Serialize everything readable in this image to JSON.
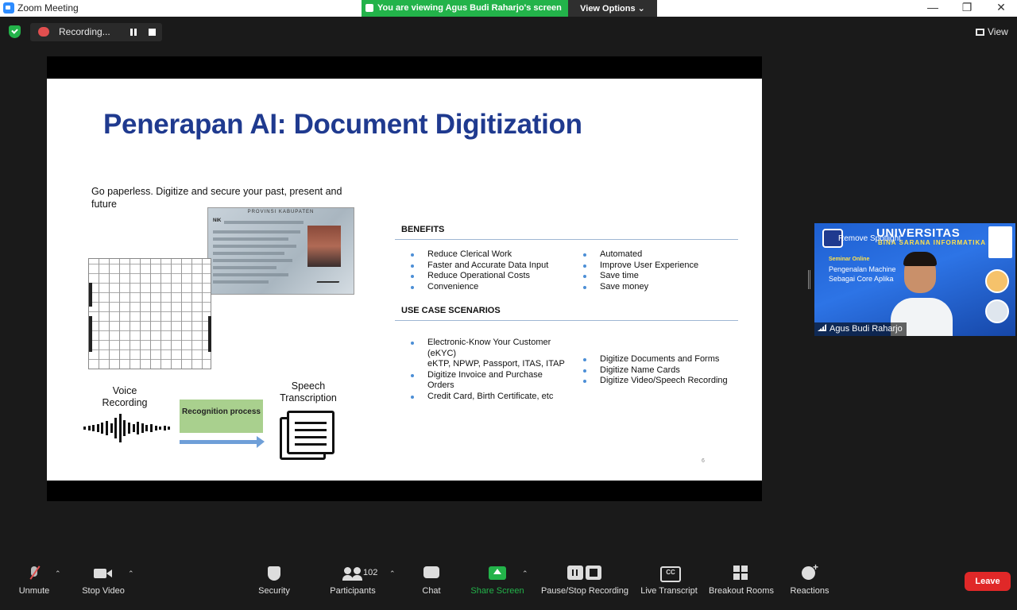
{
  "window": {
    "title": "Zoom Meeting",
    "share_banner": "You are viewing Agus Budi Raharjo's screen",
    "view_options_label": "View Options ⌄"
  },
  "top": {
    "recording_label": "Recording...",
    "view_label": "View"
  },
  "slide": {
    "title": "Penerapan AI: Document Digitization",
    "intro": "Go paperless. Digitize and secure your past, present and future",
    "voice_label": "Voice Recording",
    "recognition_label": "Recognition process",
    "speech_label": "Speech Transcription",
    "id_card_header": "PROVINSI KABUPATEN",
    "id_card_nik": "NIK",
    "benefits_heading": "BENEFITS",
    "benefits_left": [
      "Reduce Clerical Work",
      "Faster and Accurate Data Input",
      "Reduce Operational Costs",
      "Convenience"
    ],
    "benefits_right": [
      "Automated",
      "Improve User Experience",
      "Save time",
      "Save money"
    ],
    "usecase_heading": "USE CASE SCENARIOS",
    "usecase_left": [
      {
        "text": "Electronic-Know Your Customer",
        "cont": false
      },
      {
        "text": "(eKYC)",
        "cont": true
      },
      {
        "text": "eKTP, NPWP, Passport, ITAS, ITAP",
        "cont": true
      },
      {
        "text": "Digitize Invoice and Purchase",
        "cont": false
      },
      {
        "text": "Orders",
        "cont": true
      },
      {
        "text": "Credit Card, Birth Certificate, etc",
        "cont": false
      }
    ],
    "usecase_right": [
      "Digitize Documents and Forms",
      "Digitize Name Cards",
      "Digitize Video/Speech Recording"
    ],
    "page_number": "6"
  },
  "video": {
    "spotlight_label": "Remove Spotlight",
    "university": "UNIVERSITAS",
    "university_sub": "BINA SARANA INFORMATIKA",
    "seminar_label": "Seminar Online",
    "seminar_text": "Pengenalan Machine Sebagai Core Aplika",
    "participant_name": "Agus Budi Raharjo"
  },
  "toolbar": {
    "unmute": "Unmute",
    "stop_video": "Stop Video",
    "security": "Security",
    "participants": "Participants",
    "participant_count": "102",
    "chat": "Chat",
    "share_screen": "Share Screen",
    "pause_stop_recording": "Pause/Stop Recording",
    "live_transcript": "Live Transcript",
    "breakout_rooms": "Breakout Rooms",
    "reactions": "Reactions",
    "leave": "Leave"
  },
  "colors": {
    "share_green": "#23b34a",
    "slide_title_blue": "#1f3a8f",
    "leave_red": "#e02828",
    "bullet_blue": "#4c8fd6"
  }
}
